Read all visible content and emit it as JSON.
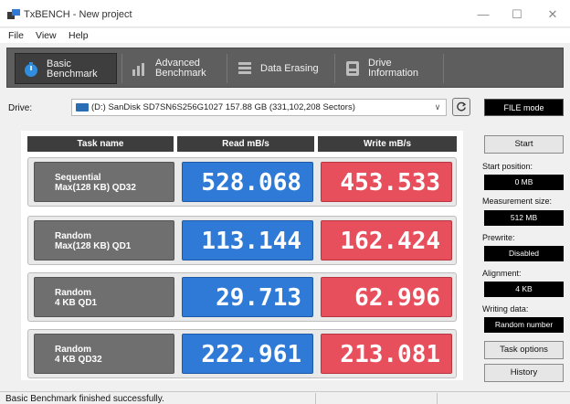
{
  "window": {
    "title": "TxBENCH - New project",
    "minimize": "—",
    "maximize": "☐",
    "close": "✕"
  },
  "menu": [
    "File",
    "View",
    "Help"
  ],
  "toolbar": [
    {
      "line1": "Basic",
      "line2": "Benchmark",
      "icon": "stopwatch-icon",
      "active": true
    },
    {
      "line1": "Advanced",
      "line2": "Benchmark",
      "icon": "bar-chart-icon",
      "active": false
    },
    {
      "line1": "Data Erasing",
      "line2": "",
      "icon": "eraser-icon",
      "active": false
    },
    {
      "line1": "Drive",
      "line2": "Information",
      "icon": "drive-info-icon",
      "active": false
    }
  ],
  "drive": {
    "label": "Drive:",
    "selected": "(D:) SanDisk SD7SN6S256G1027  157.88 GB (331,102,208 Sectors)",
    "mode": "FILE mode"
  },
  "table": {
    "headers": [
      "Task name",
      "Read mB/s",
      "Write mB/s"
    ],
    "rows": [
      {
        "line1": "Sequential",
        "line2": "Max(128 KB) QD32",
        "read": "528.068",
        "write": "453.533"
      },
      {
        "line1": "Random",
        "line2": "Max(128 KB) QD1",
        "read": "113.144",
        "write": "162.424"
      },
      {
        "line1": "Random",
        "line2": "4 KB QD1",
        "read": "29.713",
        "write": "62.996"
      },
      {
        "line1": "Random",
        "line2": "4 KB QD32",
        "read": "222.961",
        "write": "213.081"
      }
    ]
  },
  "side": {
    "start": "Start",
    "start_position_label": "Start position:",
    "start_position": "0 MB",
    "measurement_size_label": "Measurement size:",
    "measurement_size": "512 MB",
    "prewrite_label": "Prewrite:",
    "prewrite": "Disabled",
    "alignment_label": "Alignment:",
    "alignment": "4 KB",
    "writing_data_label": "Writing data:",
    "writing_data": "Random number",
    "task_options": "Task options",
    "history": "History"
  },
  "status": "Basic Benchmark finished successfully.",
  "colors": {
    "read": "#2f7ad6",
    "write": "#e84f5c",
    "toolbar": "#5e5e5e",
    "task": "#6f6f6f"
  }
}
